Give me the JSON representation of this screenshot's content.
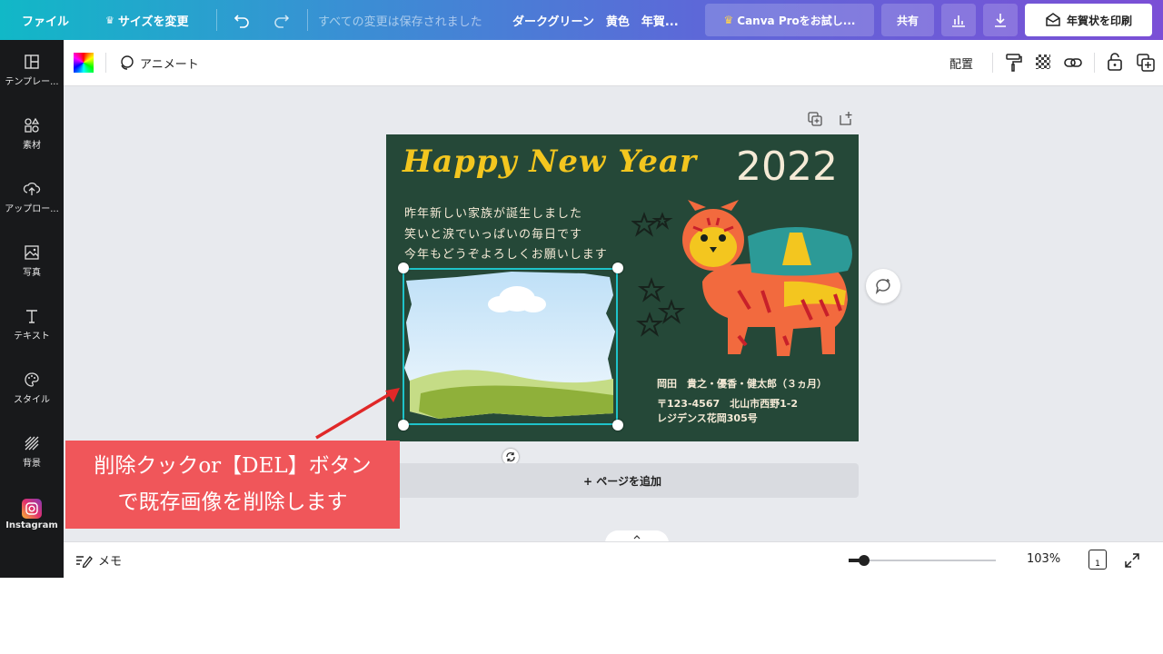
{
  "topbar": {
    "file_label": "ファイル",
    "resize_label": "サイズを変更",
    "save_status": "すべての変更は保存されました",
    "doc_title": "ダークグリーン　黄色　年賀...",
    "pro_label": "Canva Proをお試し...",
    "share_label": "共有",
    "print_label": "年賀状を印刷",
    "crown_icon": "crown-icon",
    "undo_icon": "undo-icon",
    "redo_icon": "redo-icon",
    "chart_icon": "chart-icon",
    "download_icon": "download-icon",
    "print_icon": "print-icon"
  },
  "sidebar": {
    "items": [
      {
        "label": "テンプレー...",
        "icon": "template-icon"
      },
      {
        "label": "素材",
        "icon": "elements-icon"
      },
      {
        "label": "アップロー...",
        "icon": "upload-icon"
      },
      {
        "label": "写真",
        "icon": "photo-icon"
      },
      {
        "label": "テキスト",
        "icon": "text-icon"
      },
      {
        "label": "スタイル",
        "icon": "palette-icon"
      },
      {
        "label": "背景",
        "icon": "background-icon"
      },
      {
        "label": "Instagram",
        "icon": "instagram-icon"
      }
    ]
  },
  "toolbar2": {
    "animate_label": "アニメート",
    "arrange_label": "配置"
  },
  "card": {
    "greeting": "Happy New Year",
    "year": "2022",
    "message_lines": [
      "昨年新しい家族が誕生しました",
      "笑いと涙でいっぱいの毎日です",
      "今年もどうぞよろしくお願いします"
    ],
    "sender_names": "岡田　貴之・優香・健太郎（３ヵ月）",
    "postal_line": "〒123-4567　北山市西野1-2",
    "building_line": "レジデンス花岡305号"
  },
  "add_page_label": "+ ページを追加",
  "bottombar": {
    "notes_label": "メモ",
    "zoom_label": "103%",
    "zoom_value": 0.103,
    "page_count": "1"
  },
  "annotation": {
    "line1": "削除クックor【DEL】ボタン",
    "line2": "で既存画像を削除します"
  },
  "colors": {
    "card_bg": "#254838",
    "accent_yellow": "#f3c61f",
    "selection": "#1ec3c9",
    "callout": "#f0565a"
  }
}
